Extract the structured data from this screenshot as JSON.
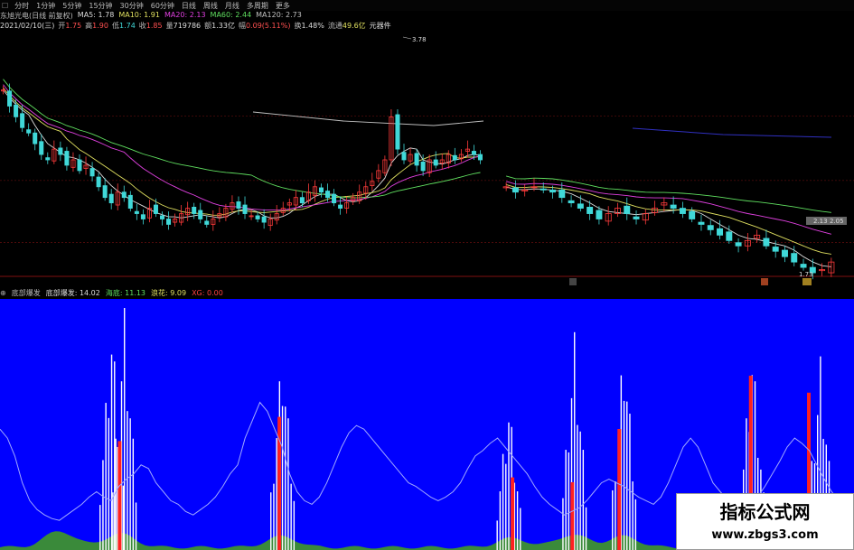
{
  "toolbar": {
    "items": [
      "分时",
      "1分钟",
      "5分钟",
      "15分钟",
      "30分钟",
      "60分钟",
      "日线",
      "周线",
      "月线",
      "多周期",
      "更多"
    ]
  },
  "info_line1": {
    "stock_name": "东旭光电(日线 前复权)",
    "ma5_label": "MA5:",
    "ma5": "1.78",
    "ma10_label": "MA10:",
    "ma10": "1.91",
    "ma20_label": "MA20:",
    "ma20": "2.13",
    "ma60_label": "MA60:",
    "ma60": "2.44",
    "ma120_label": "MA120:",
    "ma120": "2.73"
  },
  "info_line2": {
    "date": "2021/02/10(三)",
    "open_label": "开",
    "open": "1.75",
    "high_label": "高",
    "high": "1.90",
    "low_label": "低",
    "low": "1.74",
    "close_label": "收",
    "close": "1.85",
    "volume_label": "量",
    "volume": "719786",
    "amount_label": "额",
    "amount": "1.33亿",
    "change_label": "幅",
    "change": "0.09(5.11%)",
    "turnover_label": "换",
    "turnover": "1.48%",
    "float_label": "流通",
    "float": "49.6亿",
    "extra": "元器件"
  },
  "price_annotations": {
    "high_marker": "3.78",
    "mid_marker": "2.05",
    "mid_marker_left": "2.13",
    "low_marker": "1.73"
  },
  "indicator_header": {
    "name": "底部爆发",
    "param_label": "底部爆发:",
    "param_value": "14.02",
    "s1_label": "海底:",
    "s1_value": "11.13",
    "s2_label": "浪花:",
    "s2_value": "9.09",
    "s3_label": "XG:",
    "s3_value": "0.00"
  },
  "watermark": {
    "title": "指标公式网",
    "url": "www.zbgs3.com"
  },
  "colors": {
    "up": "#ff3b3b",
    "down": "#40d8d8",
    "ma5": "#dddddd",
    "ma10": "#e0e060",
    "ma20": "#e040e0",
    "ma60": "#60e060",
    "ma120": "#c0c0c0",
    "ind_bg": "#0000ff",
    "ind_line": "#a0a8ff",
    "ind_white": "#ffffff",
    "ind_red": "#ff2020",
    "ind_green": "#3a8a3a"
  },
  "chart_data": [
    {
      "type": "candlestick",
      "title": "东旭光电(日线 前复权)",
      "price_range": [
        1.7,
        3.9
      ],
      "series": [
        {
          "name": "MA5",
          "value": 1.78
        },
        {
          "name": "MA10",
          "value": 1.91
        },
        {
          "name": "MA20",
          "value": 2.13
        },
        {
          "name": "MA60",
          "value": 2.44
        },
        {
          "name": "MA120",
          "value": 2.73
        }
      ],
      "close": [
        3.45,
        3.3,
        3.2,
        3.1,
        3.05,
        2.95,
        2.85,
        2.8,
        2.9,
        2.85,
        2.75,
        2.8,
        2.7,
        2.75,
        2.65,
        2.55,
        2.45,
        2.4,
        2.5,
        2.45,
        2.35,
        2.3,
        2.25,
        2.35,
        2.3,
        2.25,
        2.2,
        2.25,
        2.3,
        2.35,
        2.3,
        2.25,
        2.2,
        2.25,
        2.3,
        2.35,
        2.4,
        2.35,
        2.3,
        2.28,
        2.25,
        2.22,
        2.25,
        2.3,
        2.35,
        2.4,
        2.45,
        2.4,
        2.5,
        2.55,
        2.5,
        2.45,
        2.4,
        2.35,
        2.4,
        2.45,
        2.5,
        2.55,
        2.6,
        2.7,
        2.8,
        3.2,
        2.9,
        2.8,
        2.85,
        2.75,
        2.7,
        2.8,
        2.75,
        2.8,
        2.85,
        2.8,
        2.85,
        2.9,
        2.85,
        2.8
      ],
      "close_late": [
        2.55,
        2.5,
        2.52,
        2.55,
        2.52,
        2.5,
        2.45,
        2.4,
        2.35,
        2.3,
        2.25,
        2.3,
        2.35,
        2.3,
        2.25,
        2.3,
        2.35,
        2.4,
        2.35,
        2.3,
        2.25,
        2.2,
        2.15,
        2.1,
        2.05,
        2.0,
        2.05,
        2.1,
        2.0,
        1.95,
        1.9,
        1.85,
        1.8,
        1.75,
        1.78,
        1.85
      ]
    },
    {
      "type": "histogram",
      "title": "底部爆发",
      "series": [
        {
          "name": "底部爆发",
          "value": 14.02
        },
        {
          "name": "海底",
          "value": 11.13
        },
        {
          "name": "浪花",
          "value": 9.09
        },
        {
          "name": "XG",
          "value": 0.0
        }
      ],
      "line": [
        60,
        55,
        45,
        30,
        20,
        15,
        12,
        10,
        9,
        12,
        15,
        18,
        22,
        25,
        22,
        20,
        28,
        32,
        35,
        40,
        38,
        30,
        25,
        20,
        18,
        14,
        12,
        15,
        18,
        22,
        28,
        35,
        40,
        55,
        65,
        75,
        70,
        60,
        50,
        35,
        25,
        20,
        18,
        22,
        30,
        40,
        50,
        58,
        62,
        60,
        55,
        50,
        45,
        40,
        35,
        30,
        28,
        25,
        22,
        20,
        22,
        25,
        30,
        38,
        45,
        48,
        52,
        55,
        50,
        45,
        40,
        35,
        28,
        22,
        18,
        15,
        12,
        14,
        16,
        20,
        25,
        30,
        32,
        30,
        28,
        25,
        22,
        20,
        18,
        22,
        30,
        40,
        50,
        55,
        50,
        40,
        30,
        25,
        20,
        18,
        16,
        18,
        22,
        28,
        35,
        42,
        50,
        55,
        52,
        48,
        40,
        32,
        25,
        20,
        15,
        12
      ],
      "white_peaks": [
        {
          "x": 0.13,
          "h": 95
        },
        {
          "x": 0.145,
          "h": 100
        },
        {
          "x": 0.33,
          "h": 85
        },
        {
          "x": 0.595,
          "h": 62
        },
        {
          "x": 0.672,
          "h": 90
        },
        {
          "x": 0.73,
          "h": 88
        },
        {
          "x": 0.88,
          "h": 85
        },
        {
          "x": 0.96,
          "h": 80
        }
      ],
      "red_peaks": [
        {
          "x": 0.138,
          "h": 45
        },
        {
          "x": 0.325,
          "h": 55
        },
        {
          "x": 0.598,
          "h": 30
        },
        {
          "x": 0.668,
          "h": 28
        },
        {
          "x": 0.723,
          "h": 50
        },
        {
          "x": 0.877,
          "h": 72
        },
        {
          "x": 0.945,
          "h": 65
        }
      ],
      "green_peaks": [
        {
          "x": 0.07,
          "h": 18
        },
        {
          "x": 0.14,
          "h": 15
        },
        {
          "x": 0.33,
          "h": 12
        },
        {
          "x": 0.6,
          "h": 10
        },
        {
          "x": 0.67,
          "h": 14
        },
        {
          "x": 0.73,
          "h": 12
        },
        {
          "x": 0.96,
          "h": 28
        }
      ]
    }
  ]
}
